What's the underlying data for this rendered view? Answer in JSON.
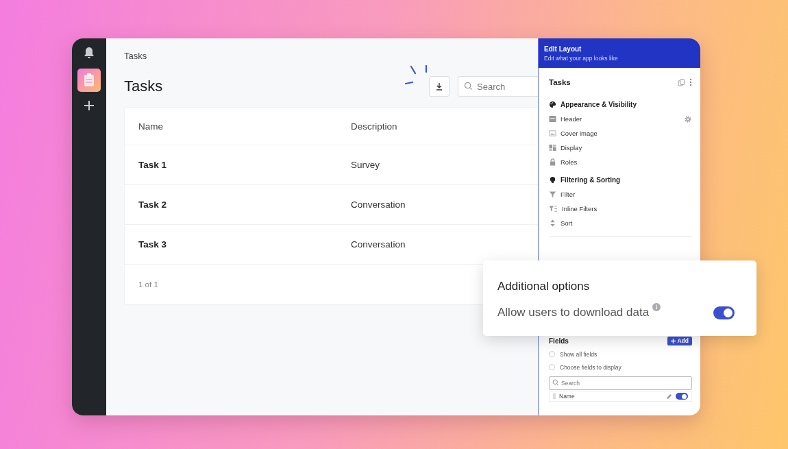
{
  "breadcrumb": "Tasks",
  "title": "Tasks",
  "search": {
    "placeholder": "Search"
  },
  "table": {
    "columns": [
      "Name",
      "Description"
    ],
    "rows": [
      [
        "Task 1",
        "Survey"
      ],
      [
        "Task 2",
        "Conversation"
      ],
      [
        "Task 3",
        "Conversation"
      ]
    ],
    "pagination": "1 of 1"
  },
  "panel": {
    "header": {
      "title": "Edit Layout",
      "subtitle": "Edit what your app looks like"
    },
    "title": "Tasks",
    "sections": [
      {
        "heading": "Appearance & Visibility",
        "items": [
          "Header",
          "Cover image",
          "Display",
          "Roles"
        ]
      },
      {
        "heading": "Filtering & Sorting",
        "items": [
          "Filter",
          "Inline Filters",
          "Sort"
        ]
      }
    ],
    "fields": {
      "heading": "Fields",
      "add_button": "Add",
      "options": [
        {
          "label": "Show all fields",
          "selected": false
        },
        {
          "label": "Choose fields to display",
          "selected": false
        }
      ],
      "search": {
        "placeholder": "Search"
      },
      "rows": [
        {
          "name": "Name",
          "on": true
        }
      ]
    }
  },
  "popup": {
    "title": "Additional options",
    "option": {
      "label": "Allow users to download data",
      "on": true
    }
  }
}
